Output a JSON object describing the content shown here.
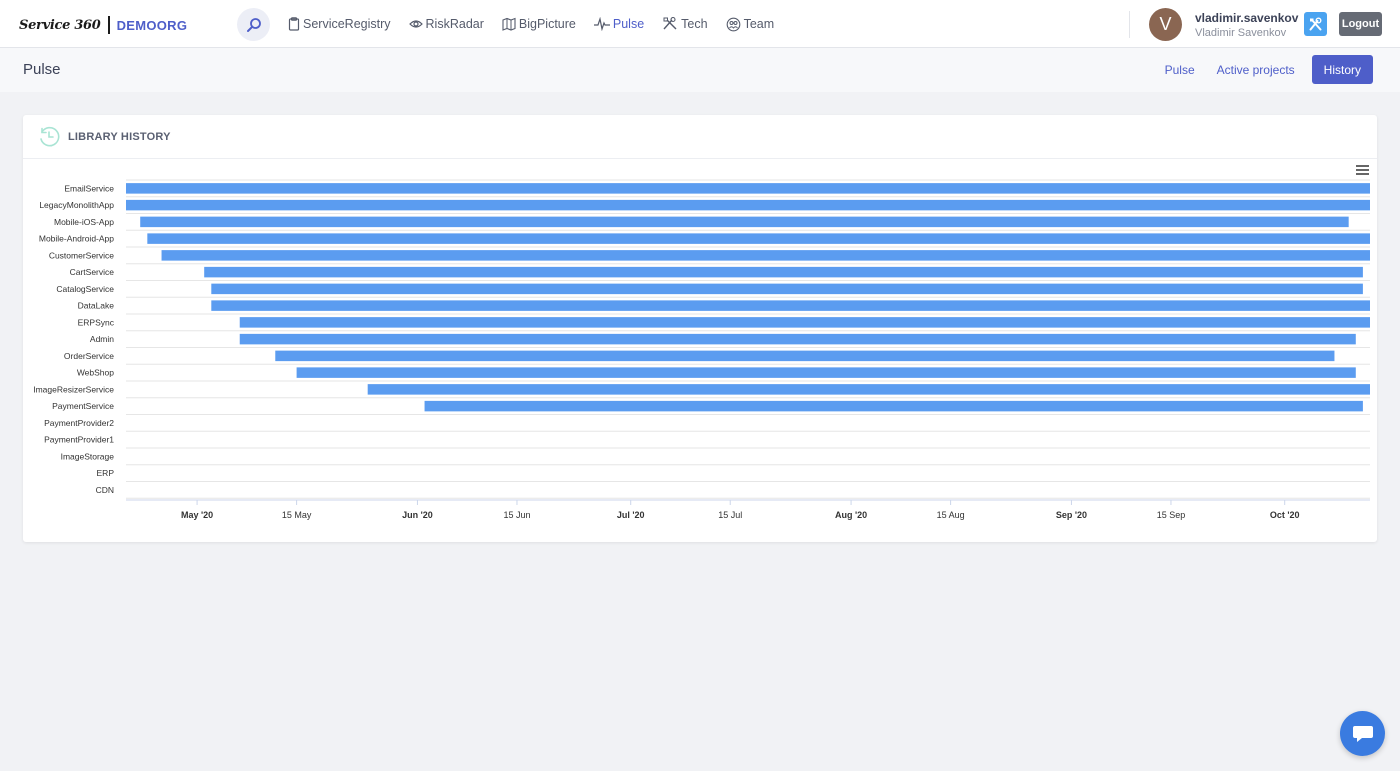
{
  "brand": {
    "logo_text": "Service 360",
    "org": "DEMOORG"
  },
  "nav": {
    "items": [
      {
        "label": "ServiceRegistry",
        "icon": "clipboard-icon"
      },
      {
        "label": "RiskRadar",
        "icon": "eye-icon"
      },
      {
        "label": "BigPicture",
        "icon": "map-icon"
      },
      {
        "label": "Pulse",
        "icon": "pulse-icon",
        "active": true
      },
      {
        "label": "Tech",
        "icon": "tools-icon"
      },
      {
        "label": "Team",
        "icon": "team-icon"
      }
    ]
  },
  "user": {
    "avatar_letter": "V",
    "login": "vladimir.savenkov",
    "full_name": "Vladimir Savenkov"
  },
  "header_buttons": {
    "logout": "Logout"
  },
  "page": {
    "title": "Pulse",
    "subnav": [
      {
        "label": "Pulse",
        "active": false
      },
      {
        "label": "Active projects",
        "active": false
      },
      {
        "label": "History",
        "active": true
      }
    ]
  },
  "card": {
    "title": "LIBRARY HISTORY"
  },
  "colors": {
    "accent": "#4e5ec9",
    "bar": "#5b9cf0",
    "chat": "#3a7be0"
  },
  "chart_data": {
    "type": "gantt",
    "title": "",
    "x_axis": {
      "type": "datetime",
      "range": [
        "2020-04-21",
        "2020-10-13"
      ],
      "ticks": [
        {
          "date": "2020-05-01",
          "label": "May '20",
          "bold": true
        },
        {
          "date": "2020-05-15",
          "label": "15 May",
          "bold": false
        },
        {
          "date": "2020-06-01",
          "label": "Jun '20",
          "bold": true
        },
        {
          "date": "2020-06-15",
          "label": "15 Jun",
          "bold": false
        },
        {
          "date": "2020-07-01",
          "label": "Jul '20",
          "bold": true
        },
        {
          "date": "2020-07-15",
          "label": "15 Jul",
          "bold": false
        },
        {
          "date": "2020-08-01",
          "label": "Aug '20",
          "bold": true
        },
        {
          "date": "2020-08-15",
          "label": "15 Aug",
          "bold": false
        },
        {
          "date": "2020-09-01",
          "label": "Sep '20",
          "bold": true
        },
        {
          "date": "2020-09-15",
          "label": "15 Sep",
          "bold": false
        },
        {
          "date": "2020-10-01",
          "label": "Oct '20",
          "bold": true
        }
      ]
    },
    "grid": true,
    "series": [
      {
        "category": "EmailService",
        "start": "2020-04-21",
        "end": "2020-10-13"
      },
      {
        "category": "LegacyMonolithApp",
        "start": "2020-04-21",
        "end": "2020-10-13"
      },
      {
        "category": "Mobile-iOS-App",
        "start": "2020-04-23",
        "end": "2020-10-10"
      },
      {
        "category": "Mobile-Android-App",
        "start": "2020-04-24",
        "end": "2020-10-13"
      },
      {
        "category": "CustomerService",
        "start": "2020-04-26",
        "end": "2020-10-13"
      },
      {
        "category": "CartService",
        "start": "2020-05-02",
        "end": "2020-10-12"
      },
      {
        "category": "CatalogService",
        "start": "2020-05-03",
        "end": "2020-10-12"
      },
      {
        "category": "DataLake",
        "start": "2020-05-03",
        "end": "2020-10-13"
      },
      {
        "category": "ERPSync",
        "start": "2020-05-07",
        "end": "2020-10-13"
      },
      {
        "category": "Admin",
        "start": "2020-05-07",
        "end": "2020-10-11"
      },
      {
        "category": "OrderService",
        "start": "2020-05-12",
        "end": "2020-10-08"
      },
      {
        "category": "WebShop",
        "start": "2020-05-15",
        "end": "2020-10-11"
      },
      {
        "category": "ImageResizerService",
        "start": "2020-05-25",
        "end": "2020-10-13"
      },
      {
        "category": "PaymentService",
        "start": "2020-06-02",
        "end": "2020-10-12"
      },
      {
        "category": "PaymentProvider2",
        "start": null,
        "end": null
      },
      {
        "category": "PaymentProvider1",
        "start": null,
        "end": null
      },
      {
        "category": "ImageStorage",
        "start": null,
        "end": null
      },
      {
        "category": "ERP",
        "start": null,
        "end": null
      },
      {
        "category": "CDN",
        "start": null,
        "end": null
      }
    ]
  }
}
